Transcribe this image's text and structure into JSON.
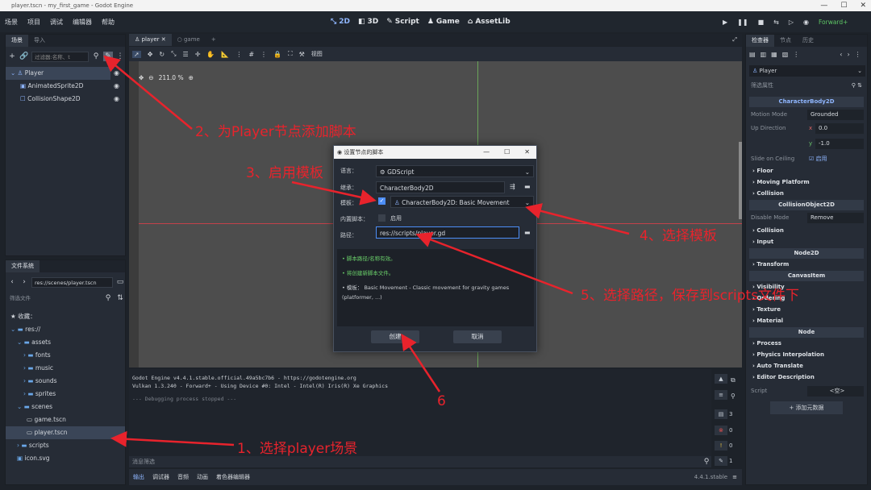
{
  "titlebar": {
    "text": "player.tscn - my_first_game - Godot Engine",
    "min": "—",
    "max": "☐",
    "close": "✕"
  },
  "menus": [
    "场景",
    "项目",
    "调试",
    "编辑器",
    "帮助"
  ],
  "workspaces": [
    {
      "label": "2D",
      "active": true
    },
    {
      "label": "3D",
      "active": false
    },
    {
      "label": "Script",
      "active": false
    },
    {
      "label": "Game",
      "active": false
    },
    {
      "label": "AssetLib",
      "active": false
    }
  ],
  "renderer": "Forward+",
  "scene_dock": {
    "tabs": [
      "场景",
      "导入"
    ],
    "filter_placeholder": "过滤器:名称、t",
    "nodes": [
      {
        "label": "Player",
        "selected": true,
        "icon": "character-body-icon"
      },
      {
        "label": "AnimatedSprite2D",
        "selected": false,
        "icon": "animated-sprite-icon"
      },
      {
        "label": "CollisionShape2D",
        "selected": false,
        "icon": "collision-shape-icon"
      }
    ]
  },
  "filesystem": {
    "tab": "文件系统",
    "path": "res://scenes/player.tscn",
    "filter_placeholder": "筛选文件",
    "favorites": "收藏：",
    "root": "res://",
    "items": [
      {
        "label": "assets",
        "type": "folder"
      },
      {
        "label": "fonts",
        "type": "folder"
      },
      {
        "label": "music",
        "type": "folder"
      },
      {
        "label": "sounds",
        "type": "folder"
      },
      {
        "label": "sprites",
        "type": "folder"
      },
      {
        "label": "scenes",
        "type": "folder"
      },
      {
        "label": "game.tscn",
        "type": "scene"
      },
      {
        "label": "player.tscn",
        "type": "scene"
      },
      {
        "label": "scripts",
        "type": "folder"
      },
      {
        "label": "icon.svg",
        "type": "image"
      }
    ]
  },
  "editor_tabs": [
    {
      "label": "player",
      "active": true
    },
    {
      "label": "game",
      "active": false
    }
  ],
  "toolbar": {
    "view": "视图"
  },
  "zoom": "211.0 %",
  "output": {
    "lines": [
      "Godot Engine v4.4.1.stable.official.49a5bc7b6 - https://godotengine.org",
      "Vulkan 1.3.240 - Forward+ - Using Device #0: Intel - Intel(R) Iris(R) Xe Graphics",
      "--- Debugging process stopped ---"
    ],
    "filter_placeholder": "消息筛选",
    "counts": {
      "log": "3",
      "errors": "0",
      "warnings": "0",
      "messages": "1"
    }
  },
  "bottom_tabs": [
    "输出",
    "调试器",
    "音频",
    "动画",
    "着色器编辑器"
  ],
  "version": "4.4.1.stable",
  "inspector": {
    "tabs": [
      "检查器",
      "节点",
      "历史"
    ],
    "object": "Player",
    "filter_placeholder": "筛选属性",
    "class_header": "CharacterBody2D",
    "props": {
      "motion_mode_label": "Motion Mode",
      "motion_mode_value": "Grounded",
      "up_direction_label": "Up Direction",
      "x_label": "x",
      "x_value": "0.0",
      "y_label": "y",
      "y_value": "-1.0",
      "slide_label": "Slide on Ceiling",
      "slide_value": "启用"
    },
    "sections1": [
      "Floor",
      "Moving Platform",
      "Collision"
    ],
    "co_header": "CollisionObject2D",
    "disable_mode_label": "Disable Mode",
    "disable_mode_value": "Remove",
    "sections2": [
      "Collision",
      "Input"
    ],
    "node2d_header": "Node2D",
    "sections3": [
      "Transform"
    ],
    "canvas_header": "CanvasItem",
    "sections4": [
      "Visibility",
      "Ordering",
      "Texture",
      "Material"
    ],
    "node_header": "Node",
    "sections5": [
      "Process",
      "Physics Interpolation",
      "Auto Translate",
      "Editor Description"
    ],
    "script_label": "Script",
    "script_value": "<空>",
    "add_meta": "添加元数据"
  },
  "dialog": {
    "title": "设置节点的脚本",
    "language_label": "语言：",
    "language_value": "GDScript",
    "inherits_label": "继承：",
    "inherits_value": "CharacterBody2D",
    "template_label": "模板：",
    "template_value": "CharacterBody2D: Basic Movement",
    "builtin_label": "内置脚本：",
    "builtin_value": "启用",
    "path_label": "路径：",
    "path_value": "res://scripts/player.gd",
    "info": [
      "• 脚本路径/名称有效。",
      "• 将创建新脚本文件。",
      "• 模板： Basic Movement - Classic movement for gravity games (platformer, ...)"
    ],
    "create": "创建",
    "cancel": "取消"
  },
  "annotations": {
    "a1": "1、选择player场景",
    "a2": "2、为Player节点添加脚本",
    "a3": "3、启用模板",
    "a4": "4、选择模板",
    "a5": "5、选择路径，保存到scripts文件下",
    "a6": "6"
  },
  "colors": {
    "annotation": "#e8232c",
    "accent": "#4d8ef7",
    "viewport": "#4d4d4d"
  }
}
